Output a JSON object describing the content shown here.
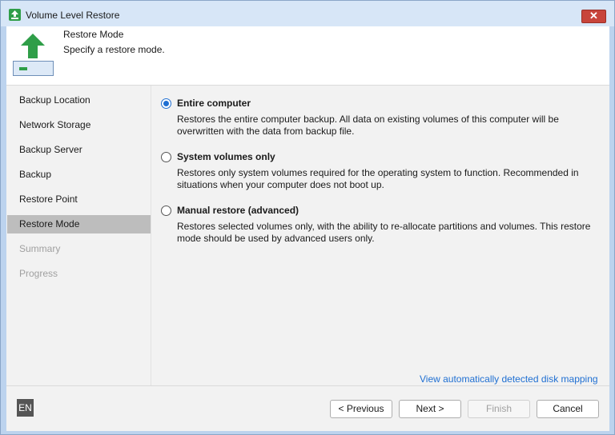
{
  "window": {
    "title": "Volume Level Restore",
    "close_glyph": "✕"
  },
  "header": {
    "title": "Restore Mode",
    "subtitle": "Specify a restore mode."
  },
  "sidebar": {
    "items": [
      {
        "label": "Backup Location",
        "state": "normal"
      },
      {
        "label": "Network Storage",
        "state": "normal"
      },
      {
        "label": "Backup Server",
        "state": "normal"
      },
      {
        "label": "Backup",
        "state": "normal"
      },
      {
        "label": "Restore Point",
        "state": "normal"
      },
      {
        "label": "Restore Mode",
        "state": "selected"
      },
      {
        "label": "Summary",
        "state": "disabled"
      },
      {
        "label": "Progress",
        "state": "disabled"
      }
    ]
  },
  "options": [
    {
      "label": "Entire computer",
      "selected": true,
      "description": "Restores the entire computer backup. All data on existing volumes of this computer will be overwritten with the data from backup file."
    },
    {
      "label": "System volumes only",
      "selected": false,
      "description": "Restores only system volumes required for the operating system to function. Recommended in situations when your computer does not boot up."
    },
    {
      "label": "Manual restore (advanced)",
      "selected": false,
      "description": "Restores selected volumes only, with the ability to re-allocate partitions and volumes. This restore mode should be used by advanced users only."
    }
  ],
  "link": {
    "label": "View automatically detected disk mapping"
  },
  "footer": {
    "language": "EN",
    "previous_label": "< Previous",
    "next_label": "Next >",
    "finish_label": "Finish",
    "cancel_label": "Cancel"
  },
  "colors": {
    "accent": "#1f6fd2",
    "selected_bg": "#bdbdbd",
    "icon_green": "#2f9e48"
  },
  "icons": [
    "restore-app-icon",
    "close-icon",
    "up-arrow-icon",
    "drive-icon"
  ]
}
